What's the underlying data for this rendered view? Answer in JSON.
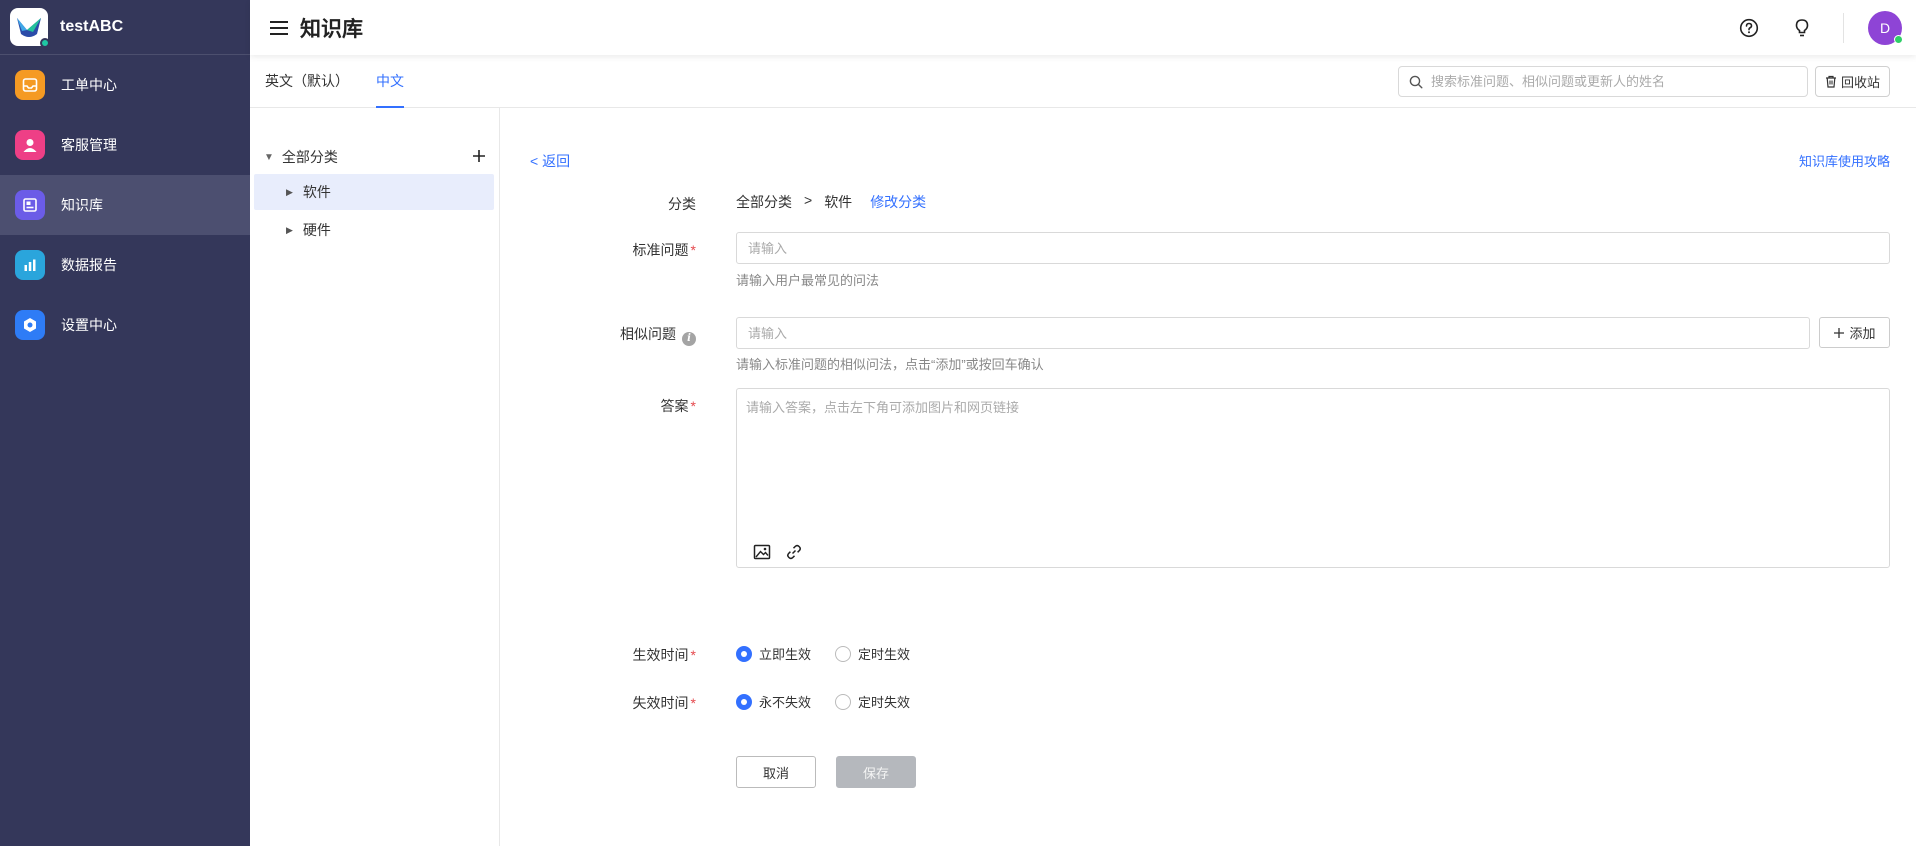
{
  "app": {
    "name": "testABC"
  },
  "sidebar": {
    "items": [
      {
        "label": "工单中心",
        "icon": "inbox-icon",
        "color": "#f59a23",
        "active": false
      },
      {
        "label": "客服管理",
        "icon": "user-icon",
        "color": "#ee3f86",
        "active": false
      },
      {
        "label": "知识库",
        "icon": "book-icon",
        "color": "#6b5ce7",
        "active": true
      },
      {
        "label": "数据报告",
        "icon": "bar-chart-icon",
        "color": "#2aa5dc",
        "active": false
      },
      {
        "label": "设置中心",
        "icon": "gear-icon",
        "color": "#2e7cf6",
        "active": false
      }
    ]
  },
  "header": {
    "title": "知识库",
    "avatar_initial": "D"
  },
  "tabs": {
    "items": [
      {
        "label": "英文（默认）",
        "active": false
      },
      {
        "label": "中文",
        "active": true
      }
    ],
    "search_placeholder": "搜索标准问题、相似问题或更新人的姓名",
    "recycle_label": "回收站"
  },
  "categories": {
    "root": "全部分类",
    "items": [
      {
        "label": "软件",
        "selected": true
      },
      {
        "label": "硬件",
        "selected": false
      }
    ]
  },
  "form": {
    "back": "< 返回",
    "guide": "知识库使用攻略",
    "category_label": "分类",
    "breadcrumb_root": "全部分类",
    "breadcrumb_sep": ">",
    "breadcrumb_current": "软件",
    "edit_category": "修改分类",
    "standard_label": "标准问题",
    "standard_placeholder": "请输入",
    "standard_hint": "请输入用户最常见的问法",
    "similar_label": "相似问题",
    "similar_placeholder": "请输入",
    "similar_hint": "请输入标准问题的相似问法，点击“添加”或按回车确认",
    "add_label": "添加",
    "answer_label": "答案",
    "answer_placeholder": "请输入答案，点击左下角可添加图片和网页链接",
    "effective_label": "生效时间",
    "effective_options": [
      "立即生效",
      "定时生效"
    ],
    "effective_selected": 0,
    "expire_label": "失效时间",
    "expire_options": [
      "永不失效",
      "定时失效"
    ],
    "expire_selected": 0,
    "required_mark": "*",
    "cancel_label": "取消",
    "save_label": "保存"
  },
  "colors": {
    "accent": "#3370ff",
    "sidebar_bg": "#34375a",
    "required": "#e5484d"
  }
}
